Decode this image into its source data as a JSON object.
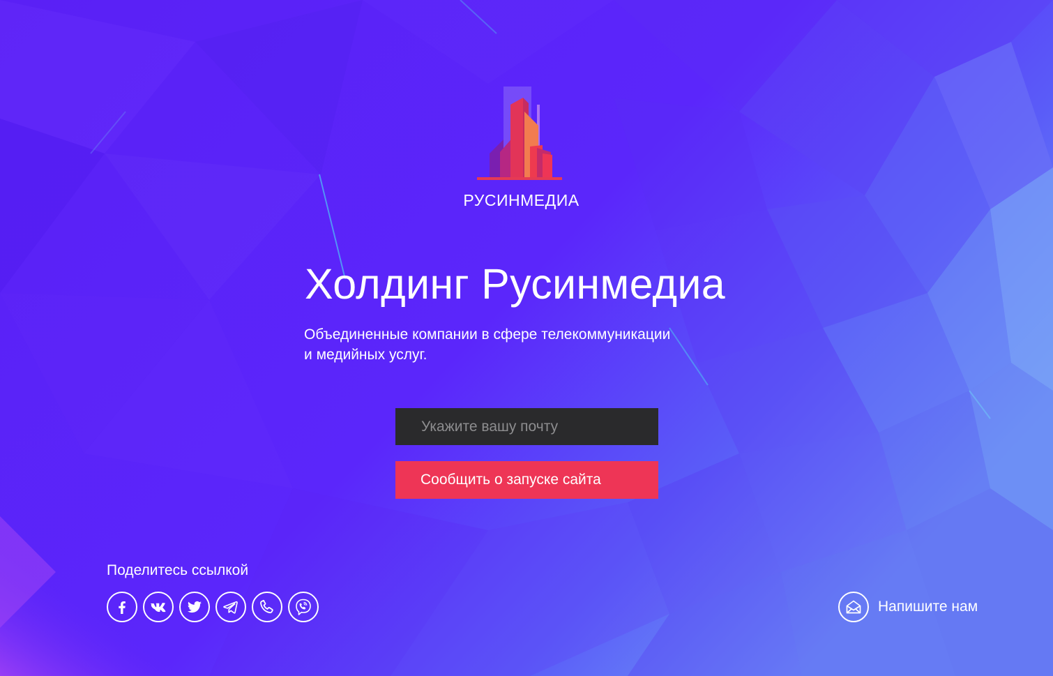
{
  "theme": {
    "background": "#5b23f7",
    "accent": "#ee3556",
    "input_bg": "#2a2a2c",
    "text": "#ffffff"
  },
  "brand": {
    "logo_icon": "buildings-logo-icon",
    "name": "РУСИНМЕДИА"
  },
  "hero": {
    "title": "Холдинг Русинмедиа",
    "subtitle_line1": "Объединенные компании в сфере телекоммуникации",
    "subtitle_line2": "и медийных услуг."
  },
  "subscribe": {
    "email_placeholder": "Укажите вашу почту",
    "email_value": "",
    "button_label": "Сообщить о запуске сайта"
  },
  "share": {
    "label": "Поделитесь ссылкой",
    "icons": [
      "facebook-icon",
      "vk-icon",
      "twitter-icon",
      "telegram-icon",
      "phone-icon",
      "viber-icon"
    ]
  },
  "contact": {
    "icon": "mail-icon",
    "label": "Напишите нам"
  }
}
